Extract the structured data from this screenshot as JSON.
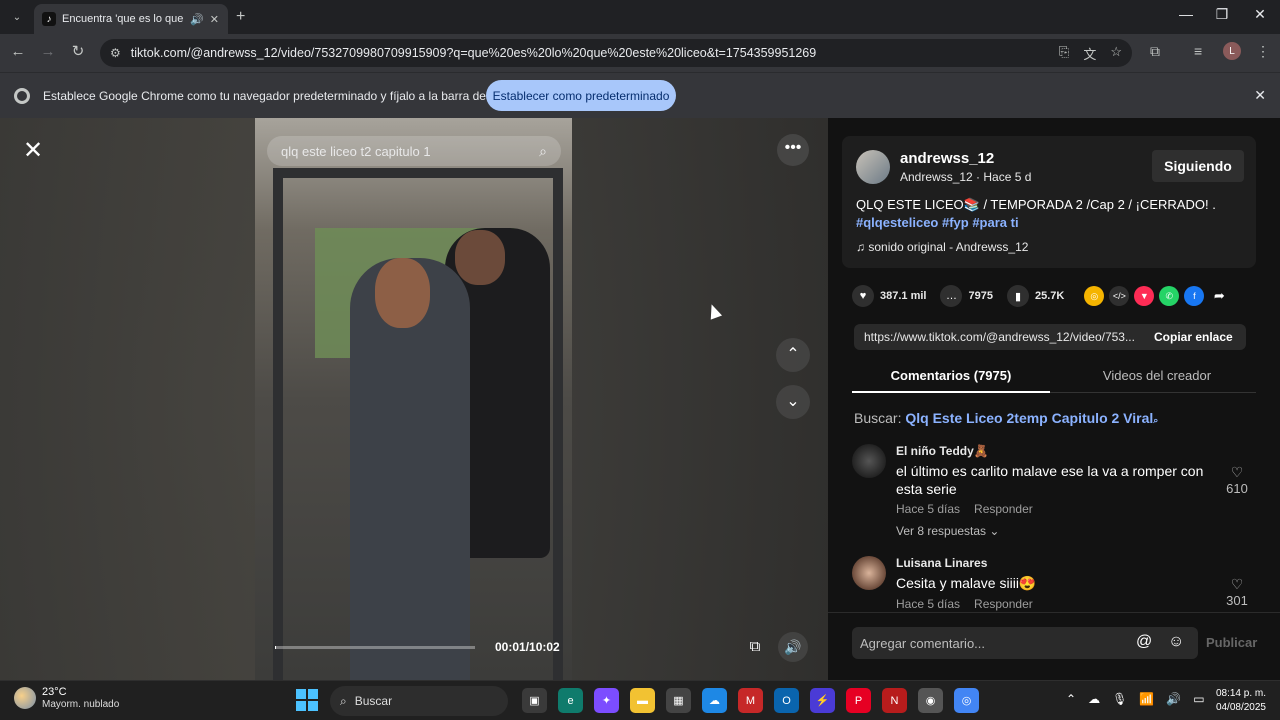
{
  "browser": {
    "tab_title": "Encuentra 'que es lo que es",
    "url": "tiktok.com/@andrewss_12/video/7532709980709915909?q=que%20es%20lo%20que%20este%20liceo&t=1754359951269",
    "avatar_letter": "L"
  },
  "infobar": {
    "message": "Establece Google Chrome como tu navegador predeterminado y fíjalo a la barra de tareas",
    "button": "Establecer como predeterminado"
  },
  "video": {
    "search_query": "qlq este liceo t2 capitulo 1",
    "time": "00:01/10:02",
    "progress_fraction": 0.002
  },
  "author": {
    "username": "andrewss_12",
    "subtitle": "Andrewss_12 · Hace 5 d",
    "follow_label": "Siguiendo",
    "description": "QLQ ESTE LICEO📚 / TEMPORADA 2 /Cap 2 / ¡CERRADO! .",
    "hashtags": "#qlqesteliceo #fyp #para ti",
    "sound": "sonido original - Andrewss_12"
  },
  "stats": {
    "likes": "387.1 mil",
    "comments": "7975",
    "saves": "25.7K"
  },
  "link": {
    "url": "https://www.tiktok.com/@andrewss_12/video/753...",
    "copy_label": "Copiar enlace"
  },
  "tabs": {
    "comments": "Comentarios (7975)",
    "creator_videos": "Videos del creador"
  },
  "search_suggest": {
    "prefix": "Buscar:",
    "query": "Qlq Este Liceo 2temp Capitulo 2 Viral"
  },
  "comments": [
    {
      "name": "El niño Teddy🧸",
      "text": "el último es carlito malave ese la va a romper con esta serie",
      "time": "Hace 5 días",
      "reply": "Responder",
      "likes": "610",
      "replies": "Ver 8 respuestas ⌄"
    },
    {
      "name": "Luisana Linares",
      "text": "Cesita y malave siiii😍",
      "time": "Hace 5 días",
      "reply": "Responder",
      "likes": "301"
    }
  ],
  "comment_box": {
    "placeholder": "Agregar comentario...",
    "publish": "Publicar"
  },
  "taskbar": {
    "temperature": "23°C",
    "condition": "Mayorm. nublado",
    "search": "Buscar",
    "time": "08:14 p. m.",
    "date": "04/08/2025"
  },
  "colors": {
    "accent": "#a8c7fa",
    "hashtag": "#8bb2ff",
    "panel_bg": "#121212"
  }
}
